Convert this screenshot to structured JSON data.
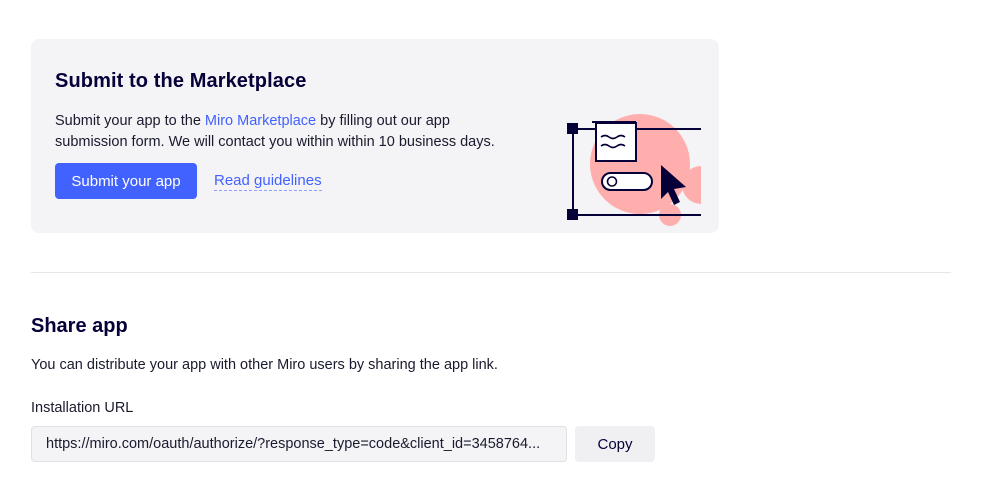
{
  "marketplace": {
    "title": "Submit to the Marketplace",
    "desc_before": "Submit your app to the ",
    "desc_link": "Miro Marketplace",
    "desc_after": " by filling out our app submission form. We will contact you within within 10 business days.",
    "submit_label": "Submit your app",
    "guidelines_label": "Read guidelines",
    "illustration": "marketplace-illustration"
  },
  "share": {
    "title": "Share app",
    "description": "You can distribute your app with other Miro users by sharing the app link.",
    "url_label": "Installation URL",
    "url_value": "https://miro.com/oauth/authorize/?response_type=code&client_id=3458764...",
    "copy_label": "Copy"
  },
  "colors": {
    "accent": "#4262ff",
    "card_bg": "#f4f4f7",
    "text_dark": "#050038",
    "illustration_pink": "#ffaeae"
  }
}
